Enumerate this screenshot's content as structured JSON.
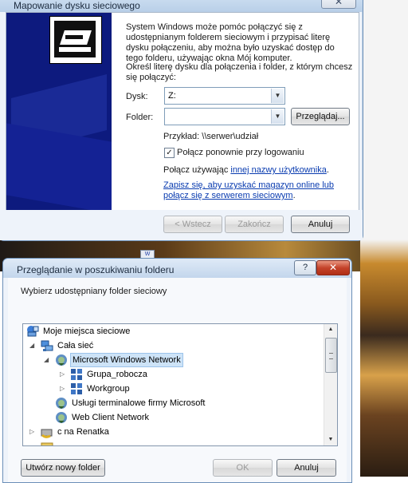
{
  "window1": {
    "title": "Mapowanie dysku sieciowego",
    "close_glyph": "✕",
    "intro": "System Windows może pomóc połączyć się z udostępnianym folderem sieciowym i przypisać literę dysku połączeniu, aby można było uzyskać dostęp do tego folderu, używając okna Mój komputer.",
    "instruction": "Określ literę dysku dla połączenia i folder, z którym chcesz się połączyć:",
    "drive_label": "Dysk:",
    "drive_value": "Z:",
    "folder_label": "Folder:",
    "folder_value": "",
    "browse_button": "Przeglądaj...",
    "example": "Przykład: \\\\serwer\\udział",
    "reconnect_label": "Połącz ponownie przy logowaniu",
    "reconnect_checked": true,
    "connect_as_prefix": "Połącz używając ",
    "connect_as_link": "innej nazwy użytkownika",
    "connect_as_suffix": ".",
    "storage_link_line1": "Zapisz się, aby uzyskać magazyn online lub",
    "storage_link_line2": "połącz się z serwerem sieciowym",
    "storage_suffix": ".",
    "back_button": "< Wstecz",
    "finish_button": "Zakończ",
    "cancel_button": "Anuluj"
  },
  "window2": {
    "title": "Przeglądanie w poszukiwaniu folderu",
    "help_glyph": "?",
    "close_glyph": "✕",
    "prompt": "Wybierz udostępniany folder sieciowy",
    "tree": [
      {
        "label": "Moje miejsca sieciowe",
        "icon": "network-places-icon"
      },
      {
        "label": "Cała sieć",
        "icon": "entire-network-icon",
        "expander": "◢"
      },
      {
        "label": "Microsoft Windows Network",
        "icon": "windows-network-icon",
        "expander": "◢",
        "selected": true
      },
      {
        "label": "Grupa_robocza",
        "icon": "workgroup-icon",
        "expander": "▷"
      },
      {
        "label": "Workgroup",
        "icon": "workgroup-icon",
        "expander": "▷"
      },
      {
        "label": "Usługi terminalowe firmy Microsoft",
        "icon": "terminal-services-icon"
      },
      {
        "label": "Web Client Network",
        "icon": "web-client-icon"
      },
      {
        "label": "c na Renatka",
        "icon": "shared-drive-icon",
        "expander": "▷"
      }
    ],
    "new_folder_button": "Utwórz nowy folder",
    "ok_button": "OK",
    "cancel_button": "Anuluj"
  },
  "colors": {
    "selection": "#cde3f7",
    "link": "#0a3cb0",
    "sidepanel": "#0d1a7e"
  }
}
